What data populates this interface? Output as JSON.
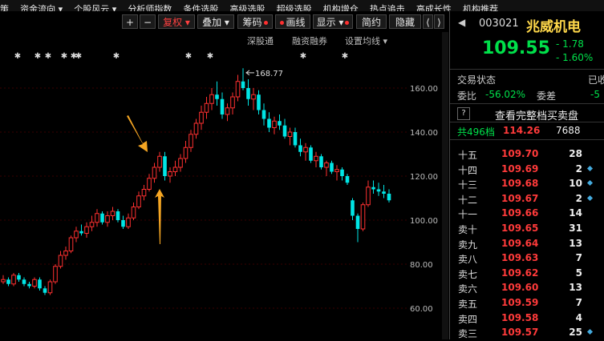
{
  "menu": [
    "策",
    "资金流向 ▾",
    "个股风云 ▾",
    "分析师指数",
    "条件选股",
    "高级选股",
    "超级选股",
    "机构增仓",
    "热点追击",
    "高成长性",
    "机构推荐"
  ],
  "toolbar": {
    "plus": "+",
    "minus": "−",
    "fuquan": "复权",
    "diejia": "叠加",
    "chouma": "筹码",
    "huaxian": "画线",
    "xianshi": "显示",
    "jianyue": "简约",
    "yincang": "隐藏",
    "prev": "⟨",
    "next": "⟩"
  },
  "sub_options": [
    "深股通",
    "融资融券",
    "设置均线 ▾"
  ],
  "chart_data": {
    "type": "candlestick",
    "y_ticks": [
      "160.00",
      "140.00",
      "120.00",
      "100.00",
      "80.00",
      "60.00"
    ],
    "ylim": [
      54,
      180
    ],
    "annotation": "168.77",
    "candles": [
      [
        72,
        75,
        71,
        73
      ],
      [
        73,
        74,
        70,
        71
      ],
      [
        71,
        76,
        70,
        75
      ],
      [
        75,
        76,
        72,
        73
      ],
      [
        73,
        74,
        70,
        71
      ],
      [
        71,
        72,
        69,
        70
      ],
      [
        70,
        74,
        69,
        73
      ],
      [
        73,
        74,
        68,
        69
      ],
      [
        69,
        70,
        66,
        67
      ],
      [
        67,
        73,
        66,
        72
      ],
      [
        72,
        80,
        71,
        79
      ],
      [
        79,
        86,
        78,
        84
      ],
      [
        84,
        88,
        82,
        86
      ],
      [
        86,
        93,
        85,
        92
      ],
      [
        92,
        97,
        90,
        95
      ],
      [
        95,
        98,
        93,
        94
      ],
      [
        94,
        99,
        92,
        97
      ],
      [
        97,
        102,
        95,
        99
      ],
      [
        99,
        105,
        97,
        103
      ],
      [
        103,
        104,
        98,
        99
      ],
      [
        99,
        104,
        97,
        102
      ],
      [
        102,
        106,
        100,
        104
      ],
      [
        104,
        105,
        99,
        100
      ],
      [
        100,
        102,
        96,
        97
      ],
      [
        97,
        103,
        96,
        101
      ],
      [
        101,
        108,
        100,
        106
      ],
      [
        106,
        113,
        105,
        111
      ],
      [
        111,
        116,
        109,
        114
      ],
      [
        114,
        121,
        113,
        119
      ],
      [
        119,
        126,
        117,
        124
      ],
      [
        124,
        131,
        122,
        129
      ],
      [
        129,
        131,
        118,
        120
      ],
      [
        120,
        124,
        117,
        122
      ],
      [
        122,
        127,
        120,
        124
      ],
      [
        124,
        130,
        122,
        128
      ],
      [
        128,
        136,
        126,
        133
      ],
      [
        133,
        141,
        131,
        139
      ],
      [
        139,
        146,
        137,
        144
      ],
      [
        144,
        152,
        141,
        149
      ],
      [
        149,
        156,
        146,
        153
      ],
      [
        153,
        160,
        150,
        157
      ],
      [
        157,
        163,
        152,
        155
      ],
      [
        155,
        158,
        146,
        148
      ],
      [
        148,
        153,
        145,
        151
      ],
      [
        151,
        158,
        148,
        156
      ],
      [
        156,
        166,
        154,
        163
      ],
      [
        163,
        169,
        159,
        160
      ],
      [
        160,
        164,
        152,
        155
      ],
      [
        155,
        160,
        150,
        157
      ],
      [
        157,
        159,
        148,
        150
      ],
      [
        150,
        153,
        143,
        146
      ],
      [
        146,
        149,
        140,
        142
      ],
      [
        142,
        147,
        139,
        145
      ],
      [
        145,
        148,
        141,
        143
      ],
      [
        143,
        146,
        137,
        138
      ],
      [
        138,
        142,
        134,
        140
      ],
      [
        140,
        142,
        133,
        134
      ],
      [
        134,
        137,
        129,
        131
      ],
      [
        131,
        135,
        127,
        133
      ],
      [
        133,
        134,
        126,
        127
      ],
      [
        127,
        131,
        124,
        129
      ],
      [
        129,
        130,
        123,
        124
      ],
      [
        124,
        127,
        120,
        126
      ],
      [
        126,
        127,
        121,
        122
      ],
      [
        122,
        125,
        118,
        123
      ],
      [
        123,
        124,
        118,
        120
      ],
      [
        120,
        121,
        116,
        117
      ],
      [
        109,
        110,
        100,
        102
      ],
      [
        102,
        103,
        90,
        96
      ],
      [
        96,
        108,
        95,
        107
      ],
      [
        107,
        118,
        106,
        115
      ],
      [
        115,
        118,
        112,
        114
      ],
      [
        114,
        117,
        111,
        113
      ],
      [
        113,
        116,
        110,
        112
      ],
      [
        112,
        114,
        108,
        109
      ]
    ],
    "colors": {
      "up": "#ff3030",
      "down": "#00e5e5"
    }
  },
  "quote": {
    "code": "003021",
    "name": "兆威机电",
    "price": "109.55",
    "change": "- 1.78",
    "change_pct": "- 1.60%",
    "trade_status_label": "交易状态",
    "trade_status_value": "已收",
    "weibi_label": "委比",
    "weibi_value": "-56.02%",
    "weicha_label": "委差",
    "weicha_value": "-5",
    "help": "?",
    "full_book": "查看完整档买卖盘",
    "total_levels": "共496档",
    "total_price": "114.26",
    "total_vol": "7688"
  },
  "orderbook": [
    {
      "level": "十五",
      "price": "109.70",
      "vol": "28",
      "mark": false
    },
    {
      "level": "十四",
      "price": "109.69",
      "vol": "2",
      "mark": true
    },
    {
      "level": "十三",
      "price": "109.68",
      "vol": "10",
      "mark": true
    },
    {
      "level": "十二",
      "price": "109.67",
      "vol": "2",
      "mark": true
    },
    {
      "level": "十一",
      "price": "109.66",
      "vol": "14",
      "mark": false
    },
    {
      "level": "卖十",
      "price": "109.65",
      "vol": "31",
      "mark": false
    },
    {
      "level": "卖九",
      "price": "109.64",
      "vol": "13",
      "mark": false
    },
    {
      "level": "卖八",
      "price": "109.63",
      "vol": "7",
      "mark": false
    },
    {
      "level": "卖七",
      "price": "109.62",
      "vol": "5",
      "mark": false
    },
    {
      "level": "卖六",
      "price": "109.60",
      "vol": "13",
      "mark": false
    },
    {
      "level": "卖五",
      "price": "109.59",
      "vol": "7",
      "mark": false
    },
    {
      "level": "卖四",
      "price": "109.58",
      "vol": "4",
      "mark": false
    },
    {
      "level": "卖三",
      "price": "109.57",
      "vol": "25",
      "mark": true
    }
  ]
}
